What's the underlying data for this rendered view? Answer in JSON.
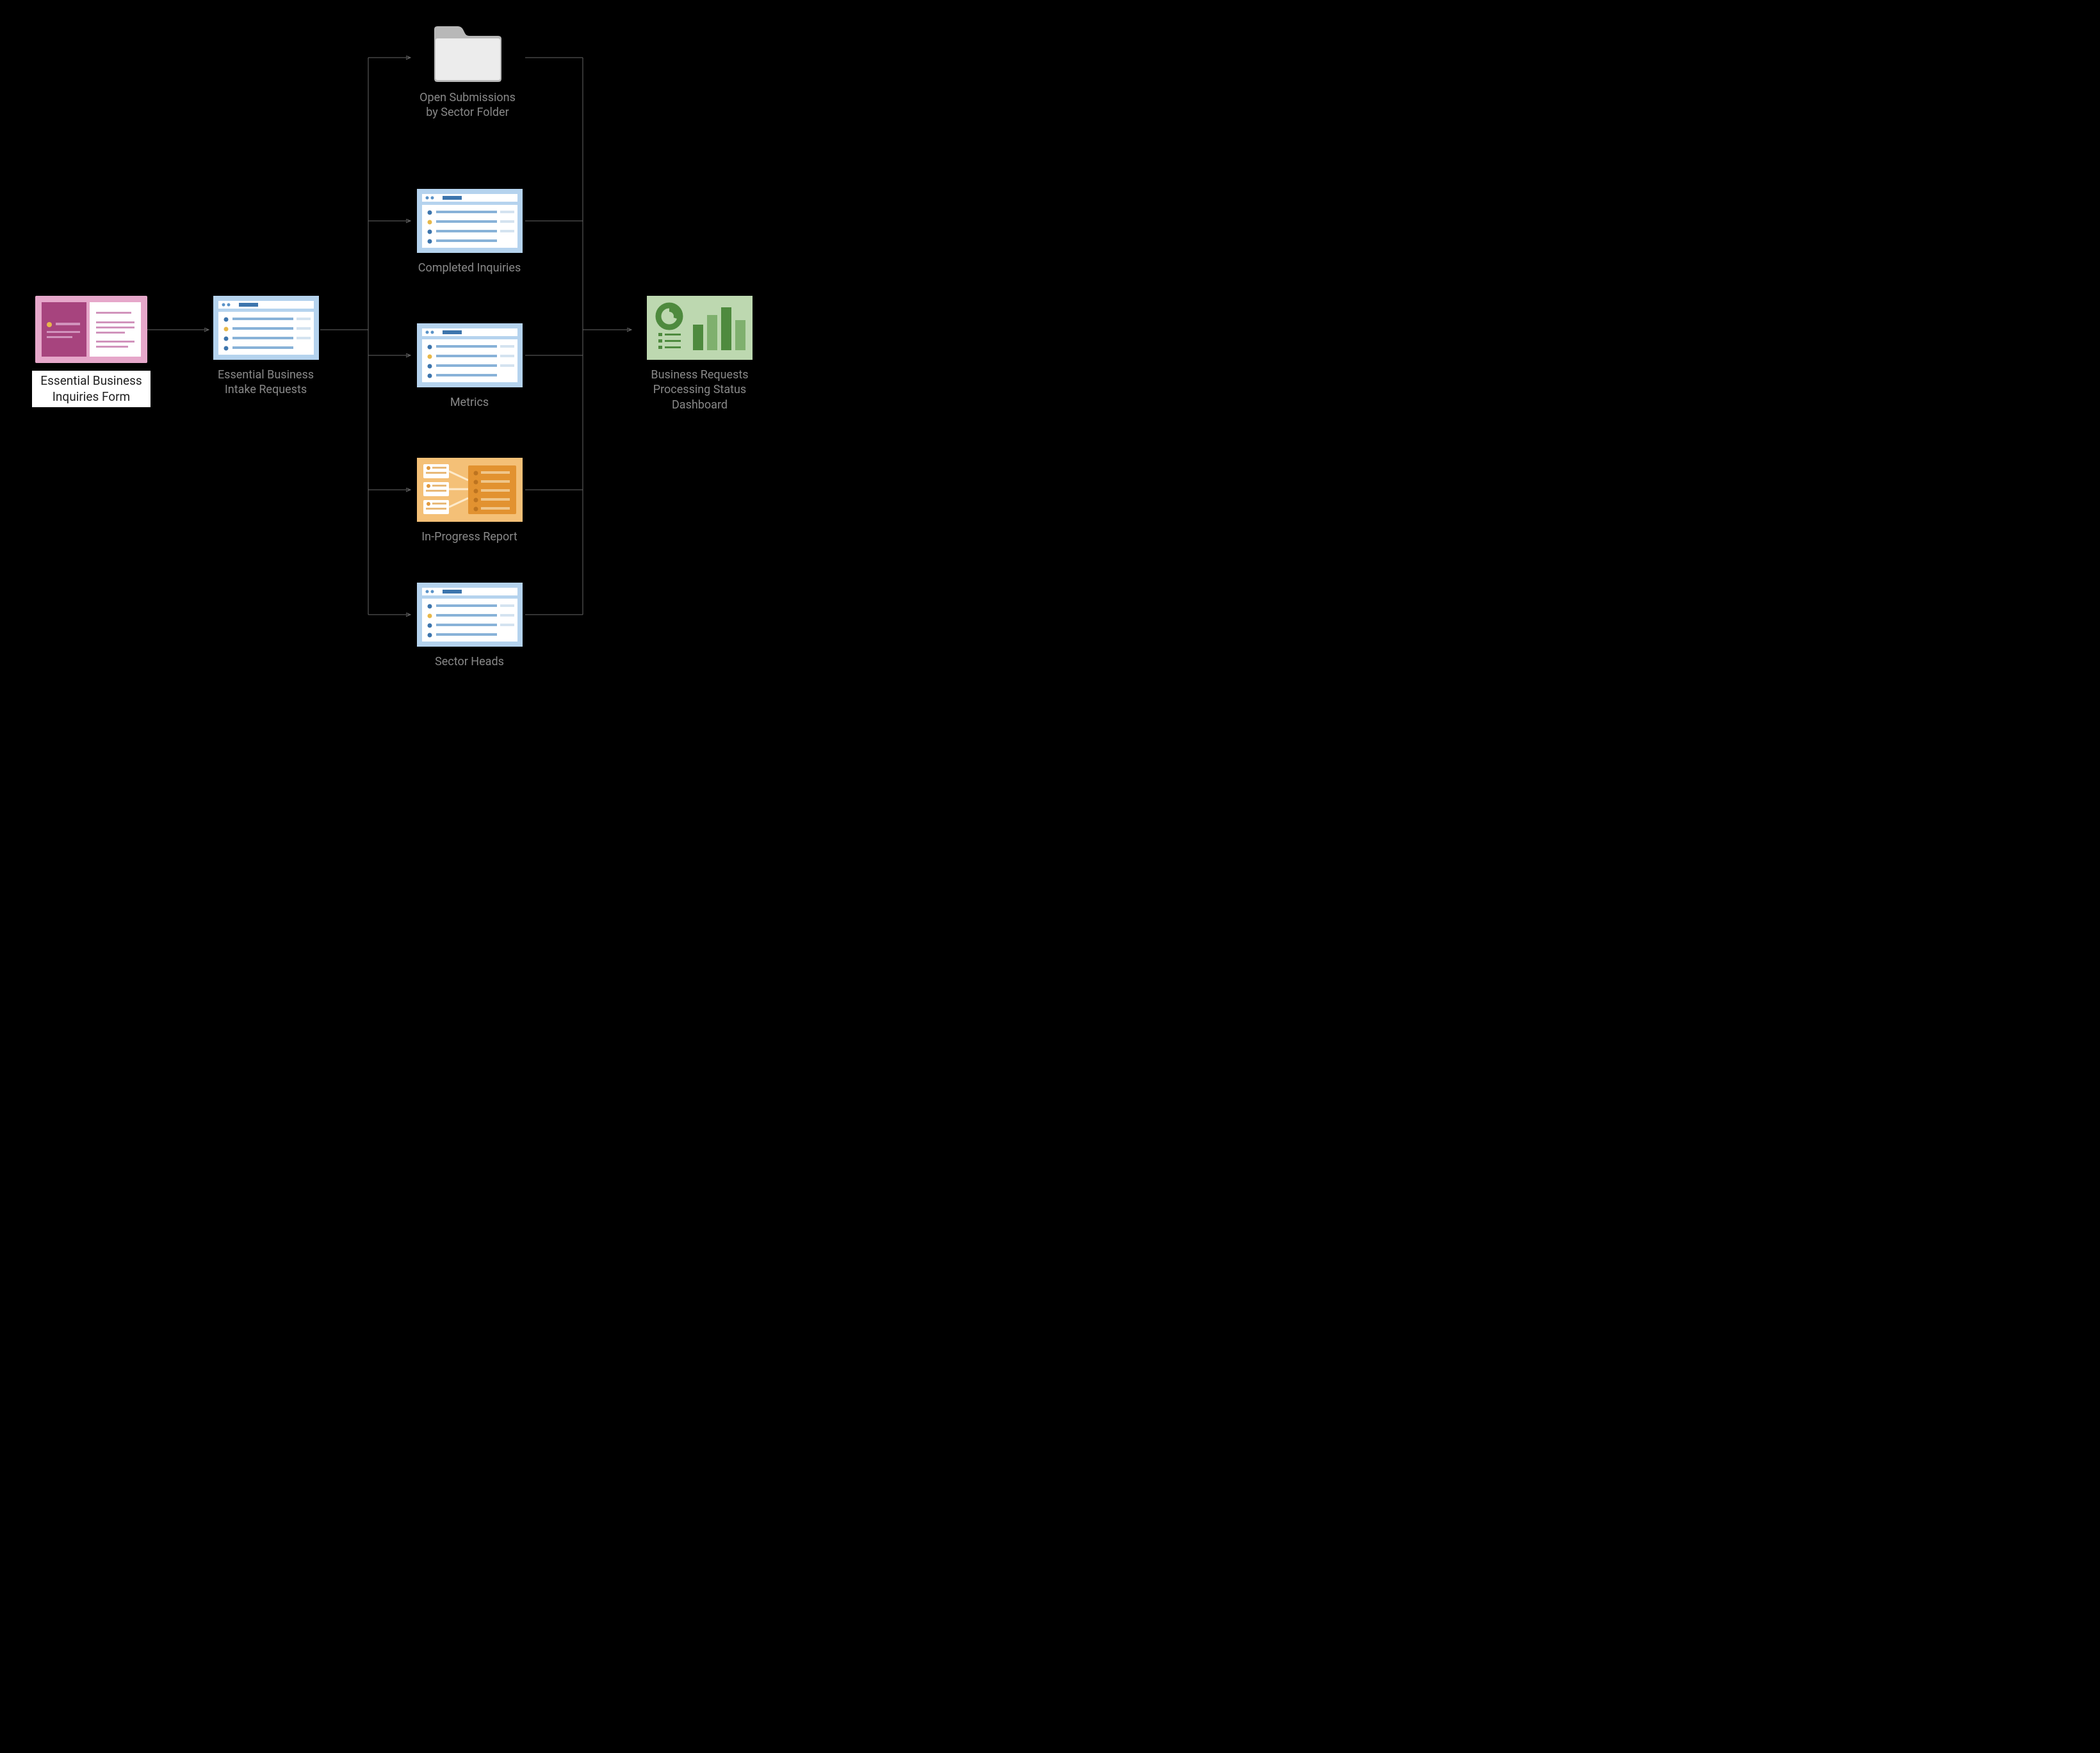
{
  "nodes": {
    "form": {
      "label": "Essential Business Inquiries Form"
    },
    "intake": {
      "label": "Essential Business Intake Requests"
    },
    "folder": {
      "label": "Open Submissions by Sector Folder"
    },
    "completed": {
      "label": "Completed Inquiries"
    },
    "metrics": {
      "label": "Metrics"
    },
    "inprogress": {
      "label": "In-Progress Report"
    },
    "sectorheads": {
      "label": "Sector Heads"
    },
    "dashboard": {
      "label": "Business Requests Processing Status Dashboard"
    }
  }
}
